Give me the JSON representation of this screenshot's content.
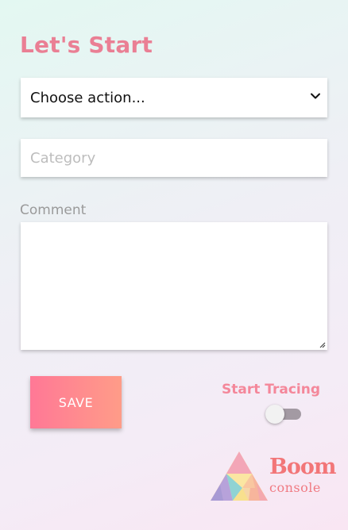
{
  "header": {
    "title": "Let's Start"
  },
  "form": {
    "action_select": {
      "selected": "Choose action..."
    },
    "category": {
      "value": "",
      "placeholder": "Category"
    },
    "comment": {
      "label": "Comment",
      "value": ""
    },
    "save_label": "SAVE",
    "tracing": {
      "label": "Start Tracing",
      "enabled": false
    }
  },
  "logo": {
    "line1": "Boom",
    "line2": "console"
  },
  "colors": {
    "accent": "#ea7f94",
    "button_gradient_start": "#ff7896",
    "button_gradient_end": "#ff9c88",
    "toggle_track": "#a39aa3"
  },
  "icons": {
    "select_arrow": "chevron-down-icon",
    "textarea_resize": "resize-grip-icon",
    "logo": "triangle-logo-icon"
  }
}
